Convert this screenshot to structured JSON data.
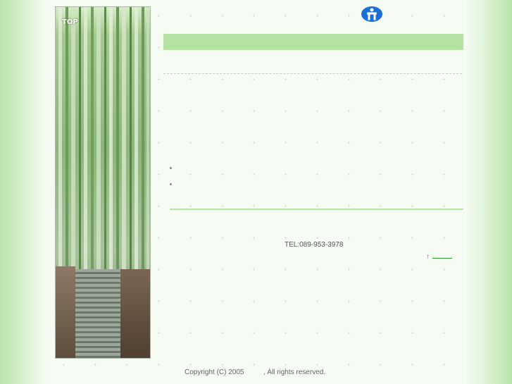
{
  "photo": {
    "top_label": "TOP",
    "alt": "bamboo-grove-photo"
  },
  "header": {
    "info_icon": "information-person-icon",
    "accent_color": "#b4e3a2",
    "icon_color": "#1a6fd6"
  },
  "list": {
    "items": [
      "",
      ""
    ]
  },
  "contact": {
    "tel": "TEL:089-953-3978"
  },
  "nav": {
    "back_to_top_arrow": "↑",
    "back_to_top_label": ""
  },
  "footer": {
    "copyright_prefix": "Copyright (C) 2005",
    "copyright_suffix": ", All rights reserved."
  }
}
